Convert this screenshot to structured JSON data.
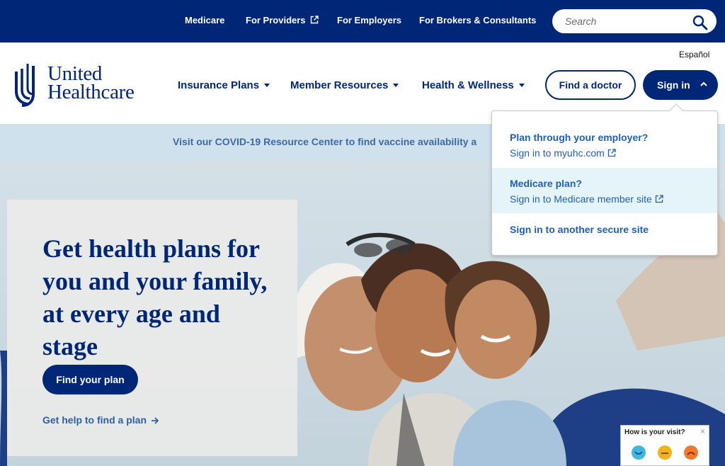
{
  "topbar": {
    "links": [
      "Medicare",
      "For Providers",
      "For Employers",
      "For Brokers & Consultants"
    ],
    "search_placeholder": "Search"
  },
  "header": {
    "language_link": "Español",
    "logo": {
      "line1": "United",
      "line2": "Healthcare"
    },
    "nav": [
      "Insurance Plans",
      "Member Resources",
      "Health & Wellness"
    ],
    "find_doctor": "Find a doctor",
    "sign_in": "Sign in"
  },
  "banner": {
    "text": "Visit our COVID-19 Resource Center to find vaccine availability a"
  },
  "hero": {
    "headline": "Get health plans for you and your family, at every age and stage",
    "cta": "Find your plan",
    "help_link": "Get help to find a plan"
  },
  "signin_menu": {
    "items": [
      {
        "title": "Plan through your employer?",
        "subtitle": "Sign in to myuhc.com"
      },
      {
        "title": "Medicare plan?",
        "subtitle": "Sign in to Medicare member site"
      },
      {
        "title": "Sign in to another secure site"
      }
    ]
  },
  "feedback": {
    "question": "How is your visit?",
    "close": "×"
  },
  "colors": {
    "brand_navy": "#002677",
    "link_blue": "#1f5fb7",
    "highlight": "#e5f4f9"
  }
}
